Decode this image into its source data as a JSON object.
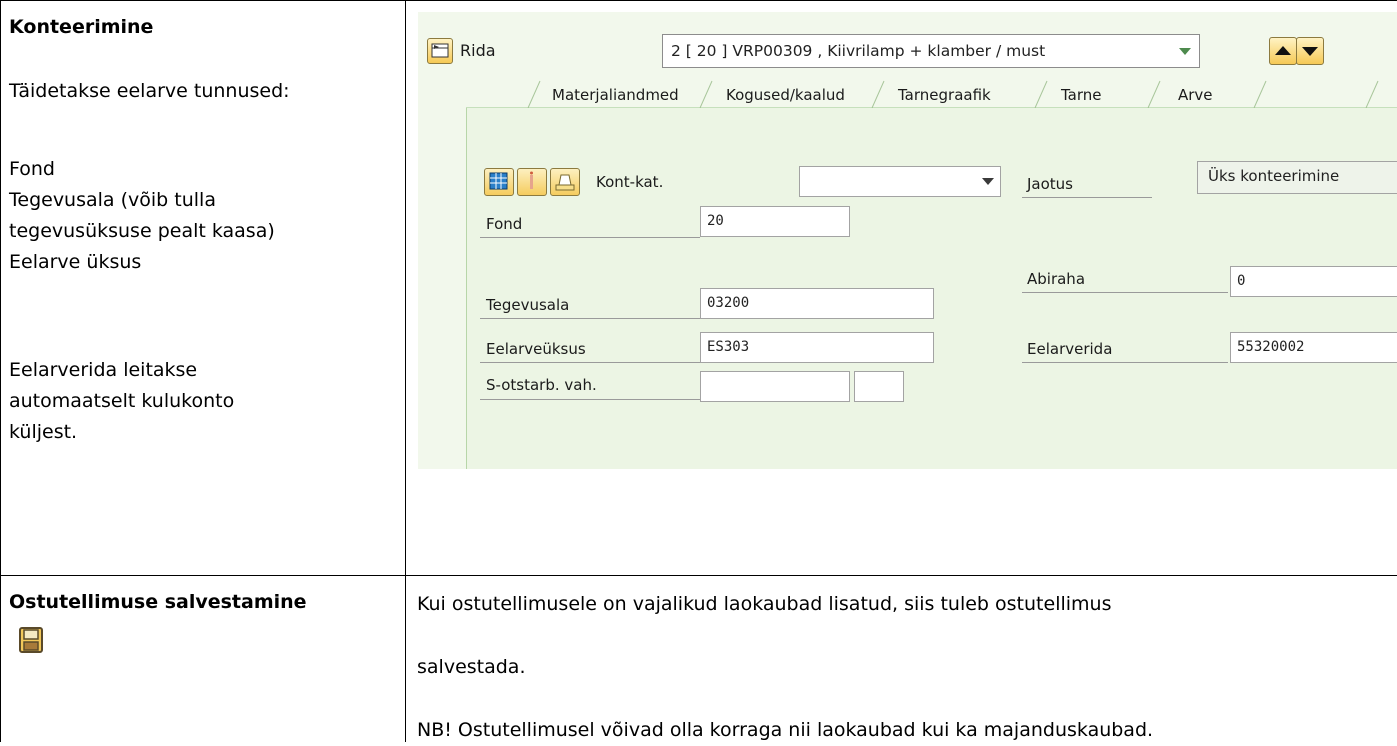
{
  "row1": {
    "title": "Konteerimine",
    "intro": "Täidetakse eelarve tunnused:",
    "items": [
      "Fond",
      "Tegevusala (võib tulla",
      "tegevusüksuse pealt kaasa)",
      "Eelarve üksus"
    ],
    "note_lines": [
      "Eelarverida leitakse",
      "automaatselt kulukonto",
      "küljest."
    ]
  },
  "sap": {
    "row_label": "Rida",
    "row_value": "2 [ 20 ] VRP00309 , Kiivrilamp + klamber / must",
    "tabs": [
      "Materjaliandmed",
      "Kogused/kaalud",
      "Tarnegraafik",
      "Tarne",
      "Arve"
    ],
    "kont_kat_label": "Kont-kat.",
    "kont_kat_value": "",
    "jaotus_label": "Jaotus",
    "jaotus_value": "Üks konteerimine",
    "fond_label": "Fond",
    "fond_value": "20",
    "abiraha_label": "Abiraha",
    "abiraha_value": "0",
    "tegevusala_label": "Tegevusala",
    "tegevusala_value": "03200",
    "eelarveuksus_label": "Eelarveüksus",
    "eelarveuksus_value": "ES303",
    "eelarverida_label": "Eelarverida",
    "eelarverida_value": "55320002",
    "sotstarb_label": "S-otstarb. vah.",
    "sotstarb_value": ""
  },
  "row2": {
    "title": "Ostutellimuse salvestamine",
    "text_lines": [
      "Kui ostutellimusele on vajalikud laokaubad lisatud, siis tuleb ostutellimus",
      "salvestada."
    ],
    "nb_line": "NB! Ostutellimusel võivad olla korraga nii laokaubad kui ka majanduskaubad."
  },
  "icons": [
    "expand-item-icon",
    "dropdown-arrow-icon",
    "arrow-up-icon",
    "arrow-down-icon",
    "table-icon",
    "info-icon",
    "print-icon",
    "save-icon"
  ]
}
